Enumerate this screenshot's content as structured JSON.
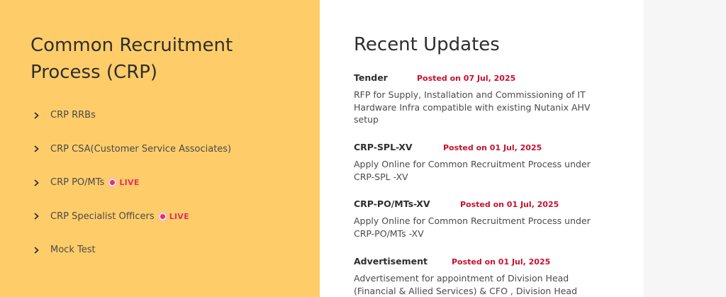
{
  "left": {
    "title": "Common Recruitment Process (CRP)",
    "items": [
      {
        "label": "CRP RRBs",
        "live": false
      },
      {
        "label": "CRP CSA(Customer Service Associates)",
        "live": false
      },
      {
        "label": "CRP PO/MTs",
        "live": true,
        "badge": "LIVE"
      },
      {
        "label": "CRP Specialist Officers",
        "live": true,
        "badge": "LIVE"
      },
      {
        "label": "Mock Test",
        "live": false
      }
    ]
  },
  "updates": {
    "title": "Recent Updates",
    "items": [
      {
        "category": "Tender",
        "date": "Posted on 07 Jul, 2025",
        "description": "RFP for Supply, Installation and Commissioning of IT Hardware Infra compatible with existing Nutanix AHV setup"
      },
      {
        "category": "CRP-SPL-XV",
        "date": "Posted on 01 Jul, 2025",
        "description": "Apply Online for Common Recruitment Process under CRP-SPL -XV"
      },
      {
        "category": "CRP-PO/MTs-XV",
        "date": "Posted on 01 Jul, 2025",
        "description": "Apply Online for Common Recruitment Process under CRP-PO/MTs -XV"
      },
      {
        "category": "Advertisement",
        "date": "Posted on 01 Jul, 2025",
        "description": "Advertisement for appointment of Division Head (Financial & Allied Services) & CFO , Division Head (Technology"
      }
    ]
  },
  "colors": {
    "left_bg": "#fecd6a",
    "date_red": "#c8102e",
    "live_pink": "#e5315f"
  }
}
